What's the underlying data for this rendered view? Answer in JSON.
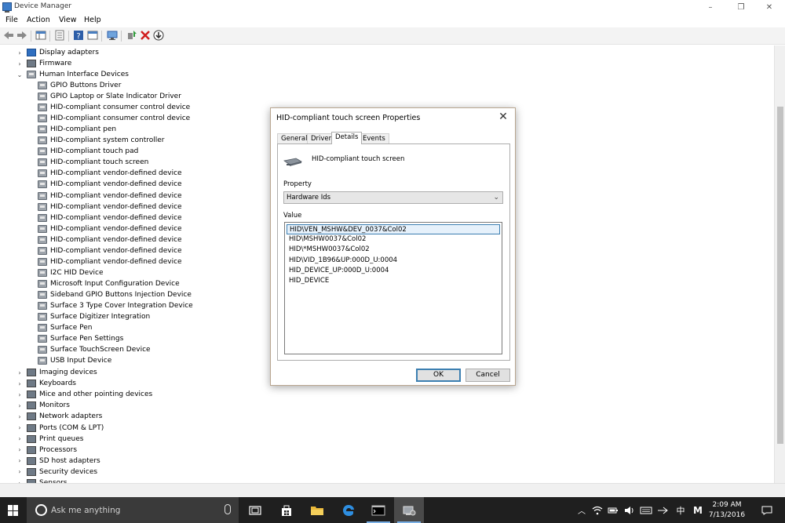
{
  "window": {
    "title": "Device Manager",
    "controls": [
      "–",
      "❐",
      "✕"
    ]
  },
  "menu": [
    "File",
    "Action",
    "View",
    "Help"
  ],
  "toolbar": [
    "back-icon",
    "forward-icon",
    "show-hide-console-tree-icon",
    "properties-icon",
    "help-icon",
    "view-icon",
    "scan-hardware-icon",
    "update-driver-icon",
    "uninstall-icon",
    "disable-icon"
  ],
  "tree": {
    "top_items": [
      {
        "label": "Display adapters",
        "expanded": false
      },
      {
        "label": "Firmware",
        "expanded": false
      },
      {
        "label": "Human Interface Devices",
        "expanded": true
      }
    ],
    "hid_children": [
      "GPIO Buttons Driver",
      "GPIO Laptop or Slate Indicator Driver",
      "HID-compliant consumer control device",
      "HID-compliant consumer control device",
      "HID-compliant pen",
      "HID-compliant system controller",
      "HID-compliant touch pad",
      "HID-compliant touch screen",
      "HID-compliant vendor-defined device",
      "HID-compliant vendor-defined device",
      "HID-compliant vendor-defined device",
      "HID-compliant vendor-defined device",
      "HID-compliant vendor-defined device",
      "HID-compliant vendor-defined device",
      "HID-compliant vendor-defined device",
      "HID-compliant vendor-defined device",
      "HID-compliant vendor-defined device",
      "I2C HID Device",
      "Microsoft Input Configuration Device",
      "Sideband GPIO Buttons Injection Device",
      "Surface 3 Type Cover Integration Device",
      "Surface Digitizer Integration",
      "Surface Pen",
      "Surface Pen Settings",
      "Surface TouchScreen Device",
      "USB Input Device"
    ],
    "bottom_items": [
      "Imaging devices",
      "Keyboards",
      "Mice and other pointing devices",
      "Monitors",
      "Network adapters",
      "Ports (COM & LPT)",
      "Print queues",
      "Processors",
      "SD host adapters",
      "Security devices",
      "Sensors"
    ]
  },
  "dialog": {
    "title": "HID-compliant touch screen Properties",
    "close": "✕",
    "tabs": [
      "General",
      "Driver",
      "Details",
      "Events"
    ],
    "active_tab": "Details",
    "device_name": "HID-compliant touch screen",
    "property_label": "Property",
    "property_value": "Hardware Ids",
    "value_label": "Value",
    "values": [
      "HID\\VEN_MSHW&DEV_0037&Col02",
      "HID\\MSHW0037&Col02",
      "HID\\*MSHW0037&Col02",
      "HID\\VID_1B96&UP:000D_U:0004",
      "HID_DEVICE_UP:000D_U:0004",
      "HID_DEVICE"
    ],
    "ok": "OK",
    "cancel": "Cancel"
  },
  "taskbar": {
    "search_placeholder": "Ask me anything",
    "apps": [
      "task-view-icon",
      "store-icon",
      "file-explorer-icon",
      "edge-icon",
      "command-prompt-icon",
      "device-manager-icon"
    ],
    "tray": {
      "language": "中",
      "ime": "M",
      "time": "2:09 AM",
      "date": "7/13/2016"
    }
  },
  "colors": {
    "accent": "#3c7fb1",
    "taskbar": "#1f1f1f",
    "dialog_border": "#b8a58f"
  }
}
